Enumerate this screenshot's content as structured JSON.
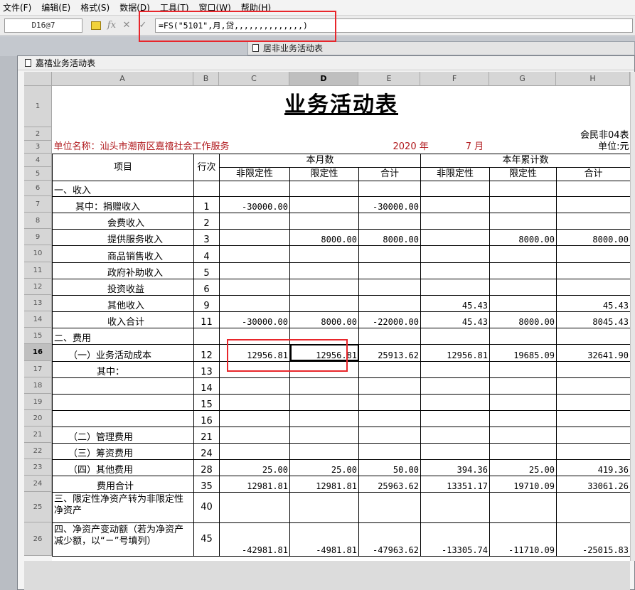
{
  "menu": [
    "文件(F)",
    "编辑(E)",
    "格式(S)",
    "数据(D)",
    "工具(T)",
    "窗口(W)",
    "帮助(H)"
  ],
  "formula_bar": {
    "cell_ref": "D16@7",
    "formula": "=FS(\"5101\",月,贷,,,,,,,,,,,,,,)",
    "fx_label": "fx"
  },
  "windows": {
    "back_title": "居非业务活动表",
    "front_title": "嘉禧业务活动表"
  },
  "columns": [
    "A",
    "B",
    "C",
    "D",
    "E",
    "F",
    "G",
    "H"
  ],
  "active": {
    "column": "D",
    "row": 16
  },
  "report": {
    "title": "业务活动表",
    "form_code": "会民非04表",
    "unit_label": "单位名称：汕头市潮南区嘉禧社会工作服务",
    "year": "2020",
    "year_label": "年",
    "month": "7",
    "month_label": "月",
    "currency_unit": "单位:元",
    "headers": {
      "item": "项目",
      "line_no": "行次",
      "current_month": "本月数",
      "ytd": "本年累计数",
      "unrestricted": "非限定性",
      "restricted": "限定性",
      "total": "合计"
    },
    "rows": [
      {
        "r": 6,
        "item": "一、收入",
        "indent": 0,
        "line": "",
        "c": "",
        "d": "",
        "e": "",
        "f": "",
        "g": "",
        "h": ""
      },
      {
        "r": 7,
        "item": "其中：捐赠收入",
        "indent": 1,
        "line": "1",
        "c": "-30000.00",
        "d": "",
        "e": "-30000.00",
        "f": "",
        "g": "",
        "h": ""
      },
      {
        "r": 8,
        "item": "会费收入",
        "indent": 2,
        "line": "2",
        "c": "",
        "d": "",
        "e": "",
        "f": "",
        "g": "",
        "h": ""
      },
      {
        "r": 9,
        "item": "提供服务收入",
        "indent": 2,
        "line": "3",
        "c": "",
        "d": "8000.00",
        "e": "8000.00",
        "f": "",
        "g": "8000.00",
        "h": "8000.00"
      },
      {
        "r": 10,
        "item": "商品销售收入",
        "indent": 2,
        "line": "4",
        "c": "",
        "d": "",
        "e": "",
        "f": "",
        "g": "",
        "h": ""
      },
      {
        "r": 11,
        "item": "政府补助收入",
        "indent": 2,
        "line": "5",
        "c": "",
        "d": "",
        "e": "",
        "f": "",
        "g": "",
        "h": ""
      },
      {
        "r": 12,
        "item": "投资收益",
        "indent": 2,
        "line": "6",
        "c": "",
        "d": "",
        "e": "",
        "f": "",
        "g": "",
        "h": ""
      },
      {
        "r": 13,
        "item": "其他收入",
        "indent": 2,
        "line": "9",
        "c": "",
        "d": "",
        "e": "",
        "f": "45.43",
        "g": "",
        "h": "45.43"
      },
      {
        "r": 14,
        "item": "收入合计",
        "indent": 2,
        "line": "11",
        "c": "-30000.00",
        "d": "8000.00",
        "e": "-22000.00",
        "f": "45.43",
        "g": "8000.00",
        "h": "8045.43"
      },
      {
        "r": 15,
        "item": "二、费用",
        "indent": 0,
        "line": "",
        "c": "",
        "d": "",
        "e": "",
        "f": "",
        "g": "",
        "h": ""
      },
      {
        "r": 16,
        "item": "（一）业务活动成本",
        "indent": 3,
        "line": "12",
        "c": "12956.81",
        "d": "12956.81",
        "e": "25913.62",
        "f": "12956.81",
        "g": "19685.09",
        "h": "32641.90"
      },
      {
        "r": 17,
        "item": "其中：",
        "indent": 4,
        "line": "13",
        "c": "",
        "d": "",
        "e": "",
        "f": "",
        "g": "",
        "h": ""
      },
      {
        "r": 18,
        "item": "",
        "indent": 0,
        "line": "14",
        "c": "",
        "d": "",
        "e": "",
        "f": "",
        "g": "",
        "h": ""
      },
      {
        "r": 19,
        "item": "",
        "indent": 0,
        "line": "15",
        "c": "",
        "d": "",
        "e": "",
        "f": "",
        "g": "",
        "h": ""
      },
      {
        "r": 20,
        "item": "",
        "indent": 0,
        "line": "16",
        "c": "",
        "d": "",
        "e": "",
        "f": "",
        "g": "",
        "h": ""
      },
      {
        "r": 21,
        "item": "（二）管理费用",
        "indent": 3,
        "line": "21",
        "c": "",
        "d": "",
        "e": "",
        "f": "",
        "g": "",
        "h": ""
      },
      {
        "r": 22,
        "item": "（三）筹资费用",
        "indent": 3,
        "line": "24",
        "c": "",
        "d": "",
        "e": "",
        "f": "",
        "g": "",
        "h": ""
      },
      {
        "r": 23,
        "item": "（四）其他费用",
        "indent": 3,
        "line": "28",
        "c": "25.00",
        "d": "25.00",
        "e": "50.00",
        "f": "394.36",
        "g": "25.00",
        "h": "419.36"
      },
      {
        "r": 24,
        "item": "费用合计",
        "indent": 4,
        "line": "35",
        "c": "12981.81",
        "d": "12981.81",
        "e": "25963.62",
        "f": "13351.17",
        "g": "19710.09",
        "h": "33061.26"
      },
      {
        "r": 25,
        "item": "三、限定性净资产转为非限定性净资产",
        "indent": 0,
        "line": "40",
        "c": "",
        "d": "",
        "e": "",
        "f": "",
        "g": "",
        "h": "",
        "wrap": true
      },
      {
        "r": 26,
        "item": "四、净资产变动额（若为净资产减少额，以“－”号填列）",
        "indent": 0,
        "line": "45",
        "c": "-42981.81",
        "d": "-4981.81",
        "e": "-47963.62",
        "f": "-13305.74",
        "g": "-11710.09",
        "h": "-25015.83",
        "wrap": true
      }
    ]
  }
}
